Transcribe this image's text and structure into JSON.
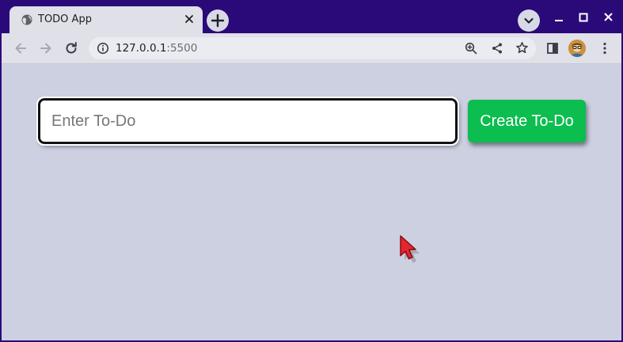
{
  "browser": {
    "tab": {
      "title": "TODO App",
      "favicon": "globe-icon"
    },
    "url": {
      "host": "127.0.0.1",
      "port": ":5500"
    }
  },
  "colors": {
    "frame": "#2a0a78",
    "page_background": "#ccd0e1",
    "button": "#0cbd4f",
    "cursor": "#e5262d"
  },
  "todo": {
    "input": {
      "placeholder": "Enter To-Do",
      "value": ""
    },
    "create_label": "Create To-Do"
  }
}
